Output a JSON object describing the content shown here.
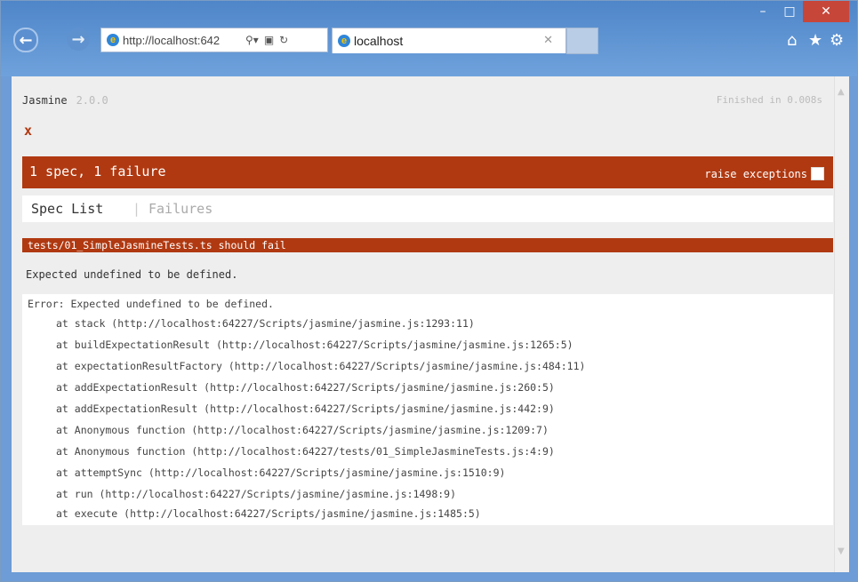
{
  "browser": {
    "address_text": "http://localhost:642",
    "tab_title": "localhost",
    "window_buttons": {
      "minimize": "–",
      "maximize": "□",
      "close": "✕"
    },
    "icons": [
      "back-arrow-icon",
      "forward-arrow-icon",
      "ie-logo-icon",
      "search-icon",
      "compat-icon",
      "refresh-icon",
      "close-icon",
      "home-icon",
      "star-icon",
      "gear-icon"
    ]
  },
  "jasmine": {
    "title": "Jasmine",
    "version": "2.0.0",
    "finished": "Finished in 0.008s",
    "result_symbol": "x",
    "summary": "1 spec, 1 failure",
    "raise_exceptions_label": "raise exceptions",
    "spec_list_label": "Spec List",
    "separator": "|",
    "failures_label": "Failures",
    "failed_spec": "tests/01_SimpleJasmineTests.ts should fail",
    "message": "Expected undefined to be defined.",
    "stack": {
      "first": "Error: Expected undefined to be defined.",
      "lines": [
        "at stack (http://localhost:64227/Scripts/jasmine/jasmine.js:1293:11)",
        "at buildExpectationResult (http://localhost:64227/Scripts/jasmine/jasmine.js:1265:5)",
        "at expectationResultFactory (http://localhost:64227/Scripts/jasmine/jasmine.js:484:11)",
        "at addExpectationResult (http://localhost:64227/Scripts/jasmine/jasmine.js:260:5)",
        "at addExpectationResult (http://localhost:64227/Scripts/jasmine/jasmine.js:442:9)",
        "at Anonymous function (http://localhost:64227/Scripts/jasmine/jasmine.js:1209:7)",
        "at Anonymous function (http://localhost:64227/tests/01_SimpleJasmineTests.js:4:9)",
        "at attemptSync (http://localhost:64227/Scripts/jasmine/jasmine.js:1510:9)",
        "at run (http://localhost:64227/Scripts/jasmine/jasmine.js:1498:9)",
        "at execute (http://localhost:64227/Scripts/jasmine/jasmine.js:1485:5)"
      ]
    }
  }
}
